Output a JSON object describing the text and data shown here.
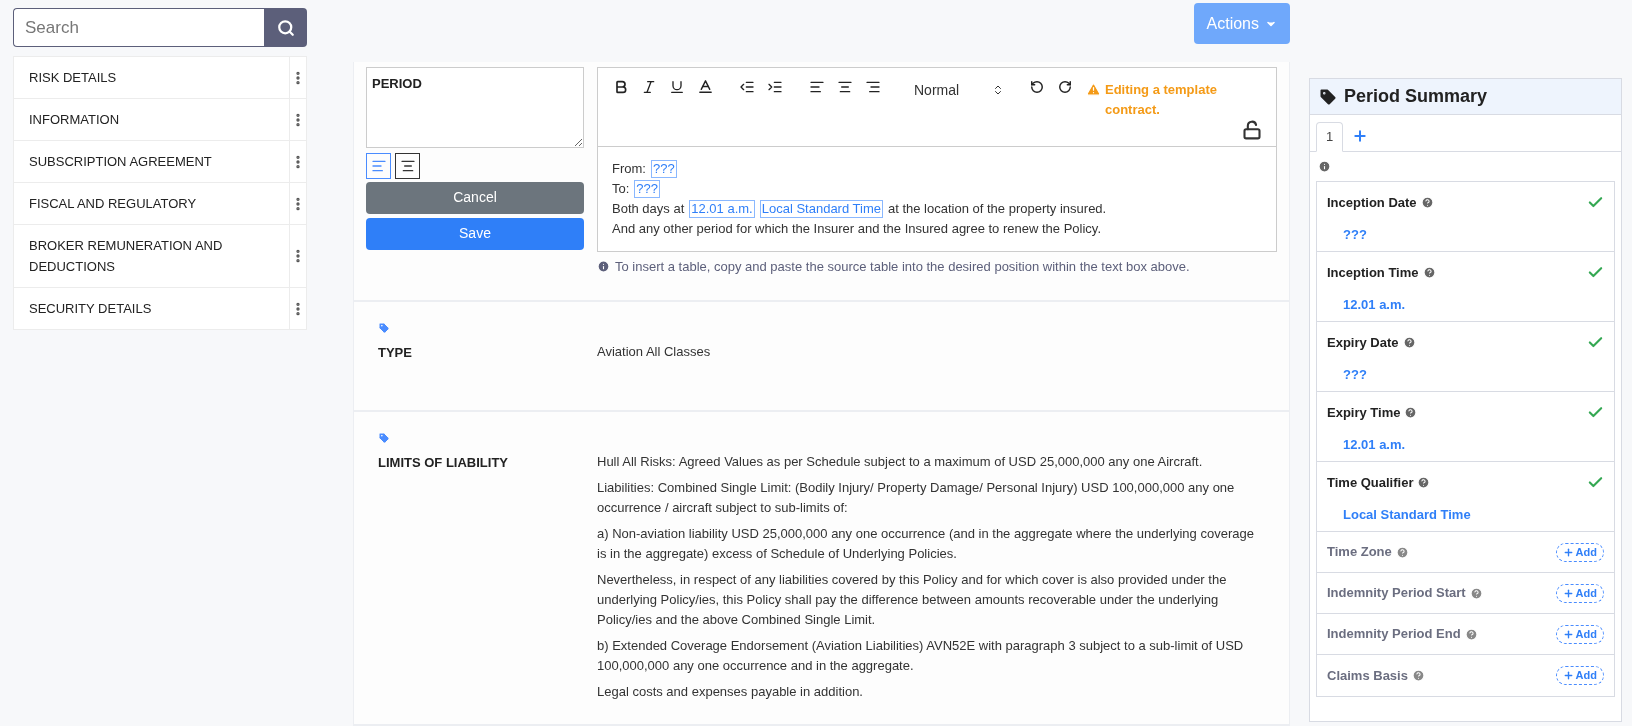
{
  "search": {
    "placeholder": "Search"
  },
  "sidebar": {
    "items": [
      {
        "label": "RISK DETAILS"
      },
      {
        "label": "INFORMATION"
      },
      {
        "label": "SUBSCRIPTION AGREEMENT"
      },
      {
        "label": "FISCAL AND REGULATORY"
      },
      {
        "label": "BROKER REMUNERATION AND DEDUCTIONS"
      },
      {
        "label": "SECURITY DETAILS"
      }
    ]
  },
  "actions_button": {
    "label": "Actions"
  },
  "period_editor": {
    "heading_value": "PERIOD",
    "alignment_buttons": [
      {
        "kind": "left",
        "selected": true
      },
      {
        "kind": "center",
        "selected": false
      }
    ],
    "cancel_button": "Cancel",
    "save_button": "Save",
    "style_select": "Normal",
    "warning": "Editing a template contract.",
    "lines": [
      [
        {
          "kind": "text",
          "text": "From:"
        },
        {
          "kind": "field",
          "text": "???"
        }
      ],
      [
        {
          "kind": "text",
          "text": "To:"
        },
        {
          "kind": "field",
          "text": "???"
        }
      ],
      [
        {
          "kind": "text",
          "text": "Both days at"
        },
        {
          "kind": "field",
          "text": "12.01 a.m."
        },
        {
          "kind": "field",
          "text": "Local Standard Time"
        },
        {
          "kind": "text",
          "text": "at the location of the property insured."
        }
      ],
      [
        {
          "kind": "text",
          "text": "And any other period for which the Insurer and the Insured agree to renew the Policy."
        }
      ]
    ],
    "hint": "To insert a table, copy and paste the source table into the desired position within the text box above."
  },
  "sections": [
    {
      "label": "TYPE",
      "paragraphs": [
        "Aviation All Classes"
      ]
    },
    {
      "label": "LIMITS OF LIABILITY",
      "paragraphs": [
        "Hull All Risks: Agreed Values as per Schedule subject to a maximum of USD 25,000,000 any one Aircraft.",
        "Liabilities: Combined Single Limit: (Bodily Injury/ Property Damage/ Personal Injury) USD 100,000,000 any one occurrence / aircraft subject to sub-limits of:",
        "a) Non-aviation liability USD 25,000,000 any one occurrence (and in the aggregate where the underlying coverage is in the aggregate) excess of Schedule of Underlying Policies.",
        "Nevertheless, in respect of any liabilities covered by this Policy and for which cover is also provided under the underlying Policy/ies, this Policy shall pay the difference between amounts recoverable under the underlying Policy/ies and the above Combined Single Limit.",
        "b) Extended Coverage Endorsement (Aviation Liabilities) AVN52E with paragraph 3 subject to a sub-limit of USD 100,000,000 any one occurrence and in the aggregate.",
        "Legal costs and expenses payable in addition."
      ]
    }
  ],
  "summary": {
    "title": "Period Summary",
    "tabs": [
      {
        "kind": "number",
        "label": "1",
        "selected": true
      },
      {
        "kind": "add",
        "selected": false
      }
    ],
    "fields": [
      {
        "kind": "filled",
        "label": "Inception Date",
        "value": "???"
      },
      {
        "kind": "filled",
        "label": "Inception Time",
        "value": "12.01 a.m."
      },
      {
        "kind": "filled",
        "label": "Expiry Date",
        "value": "???"
      },
      {
        "kind": "filled",
        "label": "Expiry Time",
        "value": "12.01 a.m."
      },
      {
        "kind": "filled",
        "label": "Time Qualifier",
        "value": "Local Standard Time"
      },
      {
        "kind": "empty",
        "label": "Time Zone",
        "button": "Add"
      },
      {
        "kind": "empty",
        "label": "Indemnity Period Start",
        "button": "Add"
      },
      {
        "kind": "empty",
        "label": "Indemnity Period End",
        "button": "Add"
      },
      {
        "kind": "empty",
        "label": "Claims Basis",
        "button": "Add"
      }
    ]
  }
}
